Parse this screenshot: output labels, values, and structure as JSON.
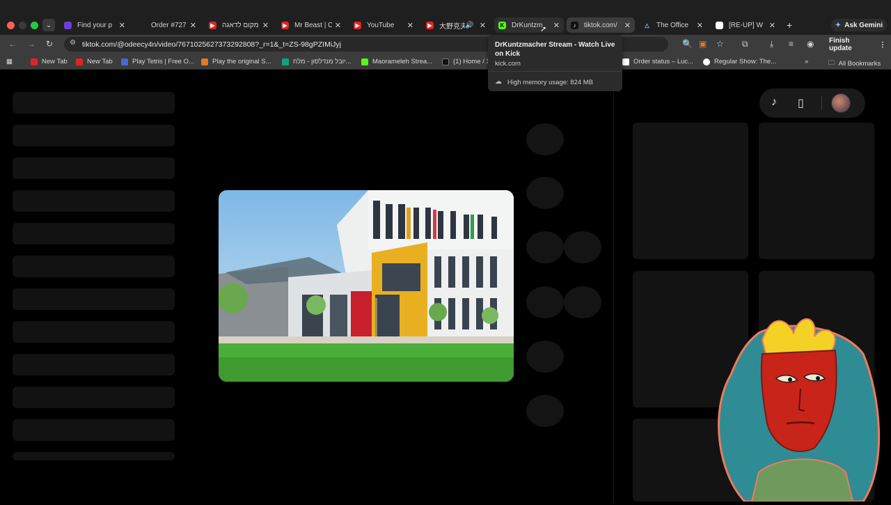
{
  "tabs": [
    {
      "label": "Find your p",
      "favicon_color": "#6b3fd6"
    },
    {
      "label": "Order #727",
      "favicon_color": "#1f1f1f"
    },
    {
      "label": "מקום לדאגה",
      "favicon_color": "#e02424"
    },
    {
      "label": "Mr Beast | C",
      "favicon_color": "#e02424"
    },
    {
      "label": "YouTube",
      "favicon_color": "#e02424"
    },
    {
      "label": "大野克夫",
      "favicon_color": "#e02424"
    },
    {
      "label": "DrKuntzm",
      "favicon_color": "#53fc18"
    },
    {
      "label": "tiktok.com/",
      "favicon_color": "#111111"
    },
    {
      "label": "The Office",
      "favicon_color": "#8ab4f8"
    },
    {
      "label": "[RE-UP] W",
      "favicon_color": "#ffffff"
    }
  ],
  "gemini_label": "Ask Gemini",
  "url": "tiktok.com/@odeecy4n/video/7671025627373292808?_r=1&_t=ZS-98gPZIMiJyj",
  "finish_update_label": "Finish update",
  "bookmarks": [
    {
      "label": "New Tab",
      "color": "#e02424"
    },
    {
      "label": "New Tab",
      "color": "#e02424"
    },
    {
      "label": "Play Tetris | Free O...",
      "color": "#4a67d6"
    },
    {
      "label": "Play the original S...",
      "color": "#e07b24"
    },
    {
      "label": "יובל מנדלסון - מלח...",
      "color": "#0fa37f"
    },
    {
      "label": "Maorameleh Strea...",
      "color": "#53fc18"
    },
    {
      "label": "(1) Home / X",
      "color": "#111111"
    },
    {
      "label": "Order status – Luc...",
      "color": "#ffffff"
    },
    {
      "label": "Regular Show: The...",
      "color": "#ffffff"
    }
  ],
  "all_bookmarks_label": "All Bookmarks",
  "tooltip": {
    "title": "DrKuntzmacher Stream - Watch Live on Kick",
    "domain": "kick.com",
    "memory": "High memory usage: 824 MB"
  }
}
